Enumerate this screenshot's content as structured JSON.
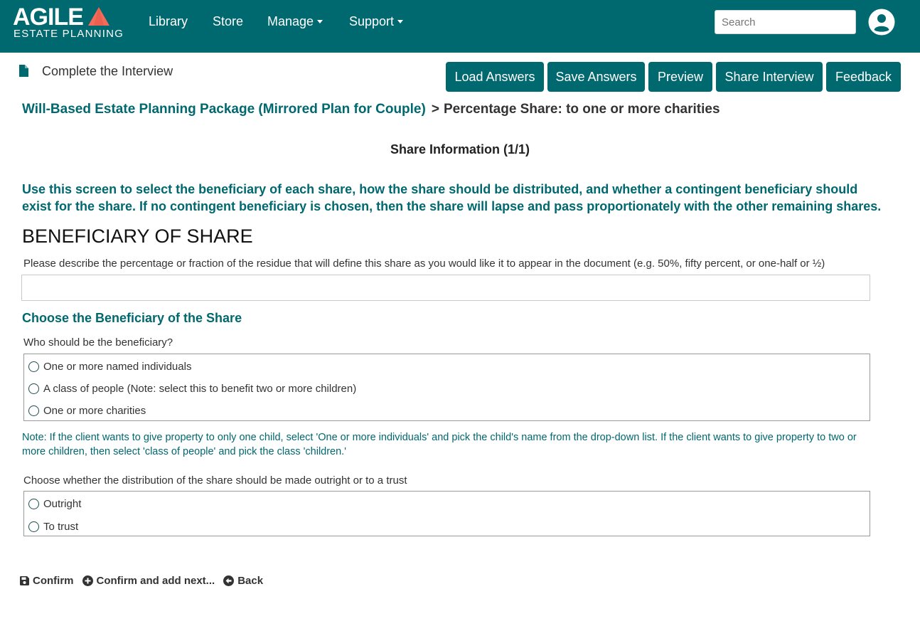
{
  "brand": {
    "word": "AGILE",
    "subtitle": "ESTATE PLANNING",
    "accent": "#f26b5b"
  },
  "colors": {
    "primary": "#00686f"
  },
  "nav": {
    "library": "Library",
    "store": "Store",
    "manage": "Manage",
    "support": "Support",
    "search_placeholder": "Search"
  },
  "toolbar": {
    "heading": "Complete the Interview",
    "buttons": [
      "Load Answers",
      "Save Answers",
      "Preview",
      "Share Interview",
      "Feedback"
    ]
  },
  "breadcrumb": {
    "parent": "Will-Based Estate Planning Package (Mirrored Plan for Couple)",
    "separator": ">",
    "current": "Percentage Share:  to one or more charities"
  },
  "section_title": "Share Information (1/1)",
  "intro": "Use this screen to select the beneficiary of each share, how the share should be distributed, and whether a contingent beneficiary should exist for the share. If no contingent beneficiary is chosen, then the share will lapse and pass proportionately with the other remaining shares.",
  "heading": "BENEFICIARY OF SHARE",
  "share_question": {
    "label": "Please describe the percentage or fraction of the residue that will define this share as you would like it to appear in the document (e.g. 50%, fifty percent, or one-half or ½)",
    "value": ""
  },
  "beneficiary_section": {
    "title": "Choose the Beneficiary of the Share",
    "question": "Who should be the beneficiary?",
    "options": [
      "One or more named individuals",
      "A class of people (Note: select this to benefit two or more children)",
      "One or more charities"
    ],
    "note": "Note: If the client wants to give property to only one child, select 'One or more individuals' and pick the child's name from the drop-down list. If the client wants to give property to two or more children, then select 'class of people' and pick the class 'children.'"
  },
  "distribution": {
    "question": "Choose whether the distribution of the share should be made outright or to a trust",
    "options": [
      "Outright",
      "To trust"
    ]
  },
  "actions": {
    "confirm": "Confirm",
    "confirm_add": "Confirm and add next...",
    "back": "Back"
  }
}
